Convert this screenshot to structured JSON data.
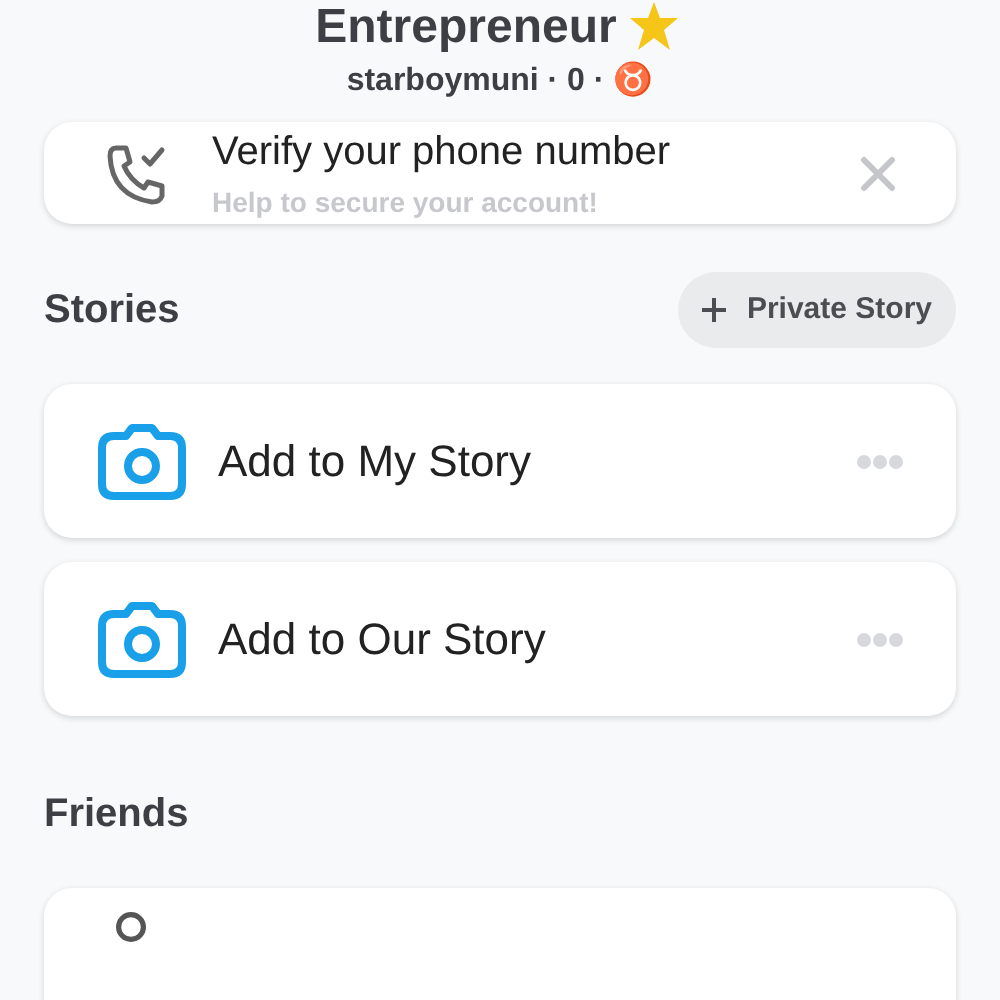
{
  "profile": {
    "title": "Entrepreneur",
    "subtitle": "starboymuni · 0 · ♉"
  },
  "verify_card": {
    "title": "Verify your phone number",
    "subtitle": "Help to secure your account!"
  },
  "stories": {
    "heading": "Stories",
    "button": "Private Story",
    "items": [
      {
        "label": "Add to My Story"
      },
      {
        "label": "Add to Our Story"
      }
    ]
  },
  "friends": {
    "heading": "Friends"
  }
}
